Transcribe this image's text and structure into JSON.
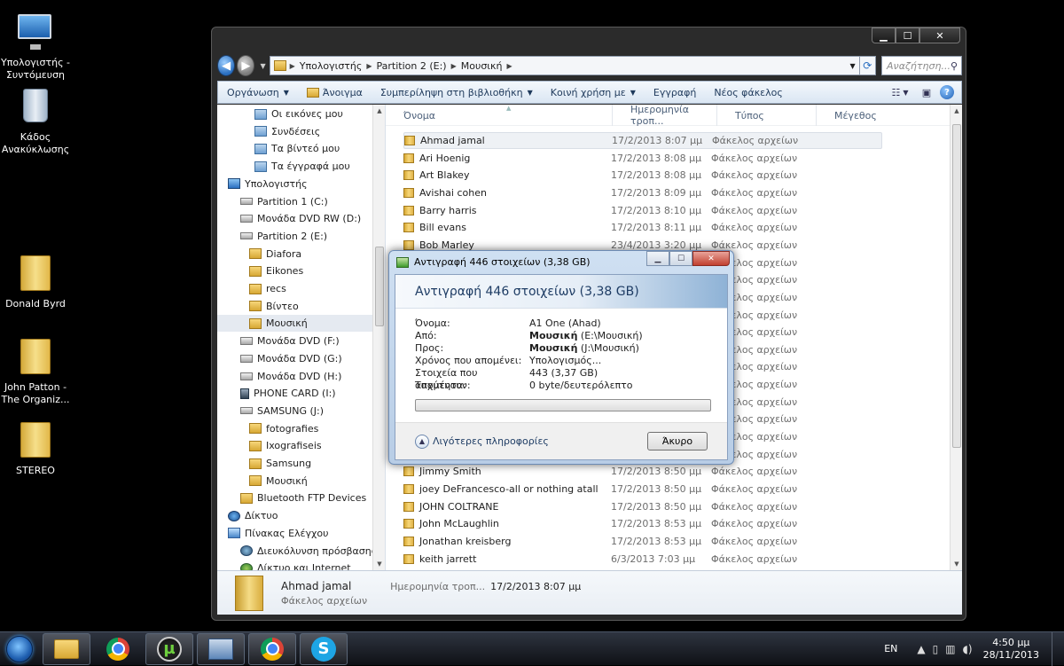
{
  "desktop": {
    "icons": [
      {
        "label": "Υπολογιστής - Συντόμευση",
        "icon": "computer-icon"
      },
      {
        "label": "Κάδος Ανακύκλωσης",
        "icon": "recycle-bin-icon"
      },
      {
        "label": "Donald Byrd",
        "icon": "folder-icon"
      },
      {
        "label": "John Patton - The Organiz...",
        "icon": "folder-icon"
      },
      {
        "label": "STEREO",
        "icon": "folder-icon"
      }
    ]
  },
  "window": {
    "controls": {
      "minimize": "▁",
      "maximize": "☐",
      "close": "✕"
    },
    "address": {
      "crumbs": [
        "Υπολογιστής",
        "Partition 2 (E:)",
        "Μουσική"
      ],
      "search_placeholder": "Αναζήτηση..."
    },
    "toolbar": {
      "organize": "Οργάνωση",
      "open": "Άνοιγμα",
      "include_library": "Συμπερίληψη στη βιβλιοθήκη",
      "share": "Κοινή χρήση με",
      "burn": "Εγγραφή",
      "new_folder": "Νέος φάκελος"
    },
    "nav_items": [
      {
        "label": "Οι εικόνες μου",
        "icon": "pictures-library-icon"
      },
      {
        "label": "Συνδέσεις",
        "icon": "links-folder-icon"
      },
      {
        "label": "Τα βίντεό μου",
        "icon": "videos-library-icon"
      },
      {
        "label": "Τα έγγραφά μου",
        "icon": "documents-library-icon"
      },
      {
        "label": "Υπολογιστής",
        "icon": "computer-icon"
      },
      {
        "label": "Partition 1 (C:)",
        "icon": "drive-icon"
      },
      {
        "label": "Μονάδα DVD RW (D:)",
        "icon": "dvd-drive-icon"
      },
      {
        "label": "Partition 2 (E:)",
        "icon": "drive-icon"
      },
      {
        "label": "Diafora",
        "icon": "folder-icon"
      },
      {
        "label": "Eikones",
        "icon": "folder-icon"
      },
      {
        "label": "recs",
        "icon": "folder-icon"
      },
      {
        "label": "Βίντεο",
        "icon": "folder-icon"
      },
      {
        "label": "Μουσική",
        "icon": "folder-icon"
      },
      {
        "label": "Μονάδα DVD (F:)",
        "icon": "dvd-drive-icon"
      },
      {
        "label": "Μονάδα DVD (G:)",
        "icon": "dvd-drive-icon"
      },
      {
        "label": "Μονάδα DVD (H:)",
        "icon": "dvd-drive-icon"
      },
      {
        "label": "PHONE CARD (I:)",
        "icon": "card-drive-icon"
      },
      {
        "label": "SAMSUNG (J:)",
        "icon": "drive-icon"
      },
      {
        "label": "fotografies",
        "icon": "folder-icon"
      },
      {
        "label": "Ixografiseis",
        "icon": "folder-icon"
      },
      {
        "label": "Samsung",
        "icon": "folder-icon"
      },
      {
        "label": "Μουσική",
        "icon": "folder-icon"
      },
      {
        "label": "Bluetooth FTP Devices",
        "icon": "folder-icon"
      },
      {
        "label": "Δίκτυο",
        "icon": "network-icon"
      },
      {
        "label": "Πίνακας Ελέγχου",
        "icon": "control-panel-icon"
      },
      {
        "label": "Διευκόλυνση πρόσβασης",
        "icon": "ease-of-access-icon"
      },
      {
        "label": "Δίκτυο και Internet",
        "icon": "network-internet-icon"
      }
    ],
    "columns": {
      "name": "Όνομα",
      "date": "Ημερομηνία τροπ...",
      "type": "Τύπος",
      "size": "Μέγεθος"
    },
    "files": [
      {
        "name": "Ahmad jamal",
        "date": "17/2/2013 8:07 μμ",
        "type": "Φάκελος αρχείων"
      },
      {
        "name": "Ari Hoenig",
        "date": "17/2/2013 8:08 μμ",
        "type": "Φάκελος αρχείων"
      },
      {
        "name": "Art Blakey",
        "date": "17/2/2013 8:08 μμ",
        "type": "Φάκελος αρχείων"
      },
      {
        "name": "Avishai cohen",
        "date": "17/2/2013 8:09 μμ",
        "type": "Φάκελος αρχείων"
      },
      {
        "name": "Barry harris",
        "date": "17/2/2013 8:10 μμ",
        "type": "Φάκελος αρχείων"
      },
      {
        "name": "Bill evans",
        "date": "17/2/2013 8:11 μμ",
        "type": "Φάκελος αρχείων"
      },
      {
        "name": "Bob Marley",
        "date": "23/4/2013 3:20 μμ",
        "type": "Φάκελος αρχείων"
      },
      {
        "name": "",
        "date": "",
        "type": "Φάκελος αρχείων"
      },
      {
        "name": "",
        "date": "",
        "type": "Φάκελος αρχείων"
      },
      {
        "name": "",
        "date": "",
        "type": "Φάκελος αρχείων"
      },
      {
        "name": "",
        "date": "",
        "type": "Φάκελος αρχείων"
      },
      {
        "name": "",
        "date": "",
        "type": "Φάκελος αρχείων"
      },
      {
        "name": "",
        "date": "",
        "type": "Φάκελος αρχείων"
      },
      {
        "name": "",
        "date": "",
        "type": "Φάκελος αρχείων"
      },
      {
        "name": "",
        "date": "",
        "type": "Φάκελος αρχείων"
      },
      {
        "name": "",
        "date": "",
        "type": "Φάκελος αρχείων"
      },
      {
        "name": "",
        "date": "",
        "type": "Φάκελος αρχείων"
      },
      {
        "name": "",
        "date": "",
        "type": "Φάκελος αρχείων"
      },
      {
        "name": "",
        "date": "",
        "type": "Φάκελος αρχείων"
      },
      {
        "name": "Jimmy Smith",
        "date": "17/2/2013 8:50 μμ",
        "type": "Φάκελος αρχείων"
      },
      {
        "name": "joey DeFrancesco-all or nothing atall",
        "date": "17/2/2013 8:50 μμ",
        "type": "Φάκελος αρχείων"
      },
      {
        "name": "JOHN COLTRANE",
        "date": "17/2/2013 8:50 μμ",
        "type": "Φάκελος αρχείων"
      },
      {
        "name": "John McLaughlin",
        "date": "17/2/2013 8:53 μμ",
        "type": "Φάκελος αρχείων"
      },
      {
        "name": "Jonathan kreisberg",
        "date": "17/2/2013 8:53 μμ",
        "type": "Φάκελος αρχείων"
      },
      {
        "name": "keith jarrett",
        "date": "6/3/2013 7:03 μμ",
        "type": "Φάκελος αρχείων"
      }
    ],
    "details": {
      "name": "Ahmad jamal",
      "date_label": "Ημερομηνία τροπ...",
      "date_value": "17/2/2013 8:07 μμ",
      "type": "Φάκελος αρχείων"
    }
  },
  "dialog": {
    "title": "Αντιγραφή 446 στοιχείων (3,38 GB)",
    "heading": "Αντιγραφή 446 στοιχείων (3,38 GB)",
    "rows": [
      {
        "label": "Όνομα:",
        "value": "A1 One (Ahad)"
      },
      {
        "label": "Από:",
        "bold": "Μουσική",
        "value": " (E:\\Μουσική)"
      },
      {
        "label": "Προς:",
        "bold": "Μουσική",
        "value": " (J:\\Μουσική)"
      },
      {
        "label": "Χρόνος που απομένει:",
        "value": "Υπολογισμός..."
      },
      {
        "label": "Στοιχεία που απομένουν:",
        "value": "443 (3,37 GB)"
      },
      {
        "label": "Ταχύτητα:",
        "value": "0 byte/δευτερόλεπτο"
      }
    ],
    "progress_percent": 0,
    "more_info": "Λιγότερες πληροφορίες",
    "cancel": "Άκυρο"
  },
  "taskbar": {
    "apps": [
      "windows-explorer-icon",
      "chrome-icon",
      "utorrent-icon",
      "network-app-icon",
      "chrome-icon",
      "skype-icon"
    ],
    "language": "EN",
    "time": "4:50 μμ",
    "date": "28/11/2013"
  }
}
